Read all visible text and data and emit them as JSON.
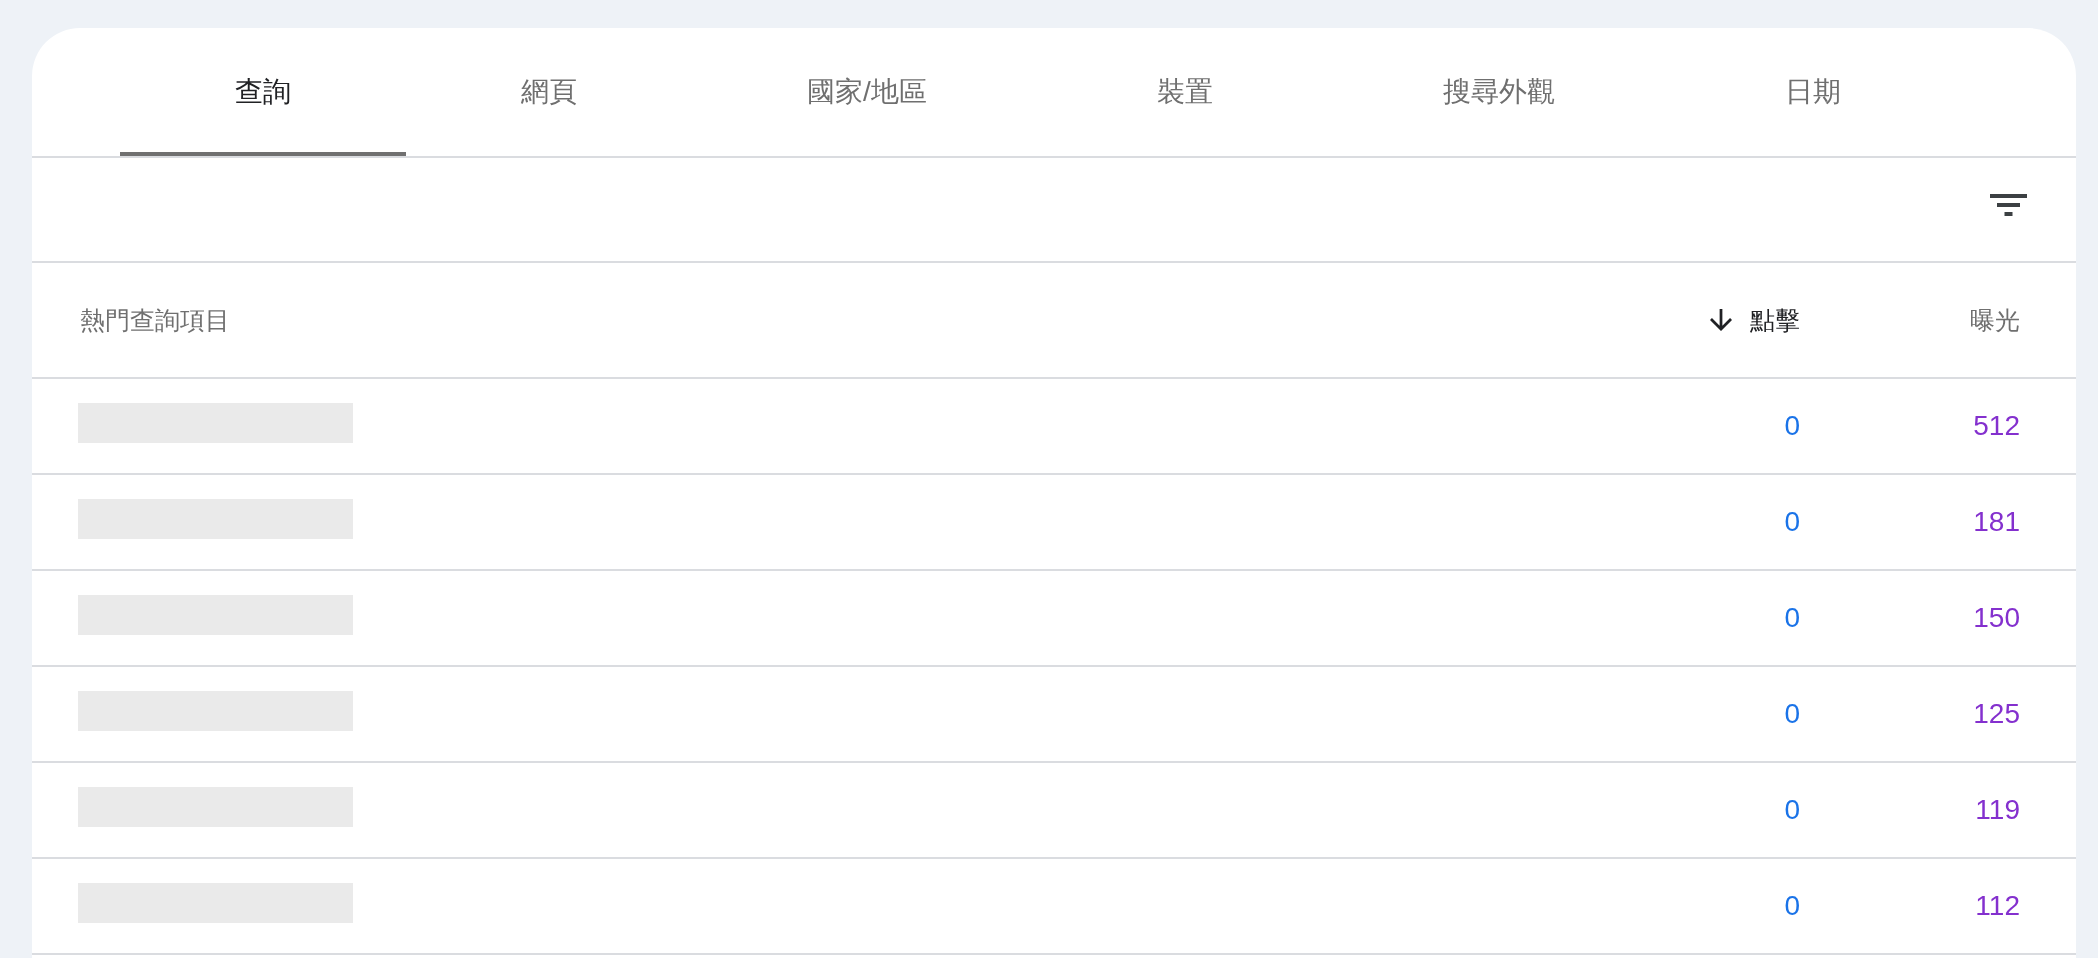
{
  "tabs": [
    {
      "label": "查詢",
      "selected": true
    },
    {
      "label": "網頁",
      "selected": false
    },
    {
      "label": "國家/地區",
      "selected": false
    },
    {
      "label": "裝置",
      "selected": false
    },
    {
      "label": "搜尋外觀",
      "selected": false
    },
    {
      "label": "日期",
      "selected": false
    }
  ],
  "table": {
    "columns": [
      {
        "label": "熱門查詢項目",
        "sorted": false
      },
      {
        "label": "點擊",
        "sorted": true
      },
      {
        "label": "曝光",
        "sorted": false
      }
    ],
    "rows": [
      {
        "clicks": "0",
        "impressions": "512"
      },
      {
        "clicks": "0",
        "impressions": "181"
      },
      {
        "clicks": "0",
        "impressions": "150"
      },
      {
        "clicks": "0",
        "impressions": "125"
      },
      {
        "clicks": "0",
        "impressions": "119"
      },
      {
        "clicks": "0",
        "impressions": "112"
      }
    ]
  }
}
